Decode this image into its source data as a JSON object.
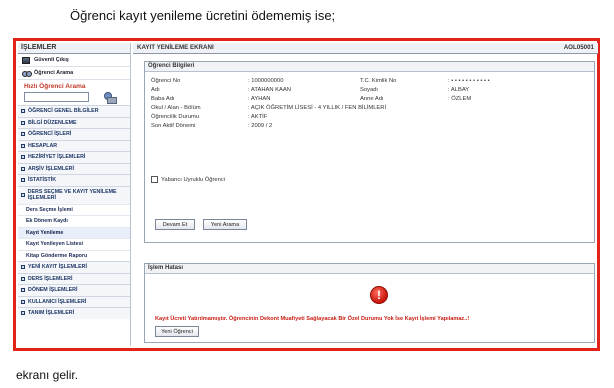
{
  "doc": {
    "intro": "Öğrenci kayıt yenileme ücretini ödememiş ise;",
    "outro": "ekranı gelir."
  },
  "sidebar": {
    "header": "İŞLEMLER",
    "actions": [
      {
        "label": "Güvenli Çıkış",
        "icon": "exit-icon"
      },
      {
        "label": "Öğrenci Arama",
        "icon": "binoculars-icon"
      }
    ],
    "quick_search_title": "Hızlı Öğrenci Arama",
    "quick_search_value": "",
    "menu": [
      "ÖĞRENCİ GENEL BİLGİLER",
      "BİLGİ DÜZENLEME",
      "ÖĞRENCİ İŞLERİ",
      "HESAPLAR",
      "HEZİRİYET İŞLEMLERİ",
      "ARŞİV İŞLEMLERİ",
      "İSTATİSTİK"
    ],
    "menu_open": "DERS SEÇME VE KAYIT YENİLEME İŞLEMLERİ",
    "submenu": [
      "Ders Seçme İşlemi",
      "Ek Dönem Kaydı",
      "Kayıt Yenileme",
      "Kayıt Yenileyen Listesi",
      "Kitap Gönderme Raporu"
    ],
    "menu_after": [
      "YENİ KAYIT İŞLEMLERİ",
      "DERS İŞLEMLERİ",
      "DÖNEM İŞLEMLERİ",
      "KULLANICI İŞLEMLERİ",
      "TANIM İŞLEMLERİ"
    ]
  },
  "main": {
    "title": "KAYIT YENİLEME EKRANI",
    "code": "AOL05001",
    "student_panel": {
      "title": "Öğrenci Bilgileri",
      "rows": [
        {
          "label": "Öğrenci No",
          "value": ": 1000000000",
          "label2": "T.C. Kimlik No",
          "value2": ": • • • • • • • • • • •"
        },
        {
          "label": "Adı",
          "value": ": ATAHAN KAAN",
          "label2": "Soyadı",
          "value2": ": ALBAY"
        },
        {
          "label": "Baba Adı",
          "value": ": AYHAN",
          "label2": "Anne Adı",
          "value2": ": ÖZLEM"
        },
        {
          "label": "Okul / Alan - Bölüm",
          "value": ": AÇIK ÖĞRETİM LİSESİ - 4 YILLIK / FEN BİLİMLERİ",
          "label2": "",
          "value2": ""
        },
        {
          "label": "Öğrencilik Durumu",
          "value": ": AKTİF",
          "label2": "",
          "value2": ""
        },
        {
          "label": "Son Aktif Dönemi",
          "value": ": 2009 / 2",
          "label2": "",
          "value2": ""
        }
      ],
      "checkbox_label": "Yabancı Uyruklu Öğrenci",
      "checkbox_checked": false,
      "continue_button": "Devam Et",
      "new_search_button": "Yeni Arama"
    },
    "error_panel": {
      "title": "İşlem Hatası",
      "message": "Kayıt Ücreti Yatırılmamıştır. Öğrencinin Dekont Muafiyeti Sağlayacak Bir Özel Durumu Yok İse Kayıt İşlemi Yapılamaz..!",
      "new_student_button": "Yeni Öğrenci"
    }
  },
  "colors": {
    "frame_border": "#e2231a",
    "error_text": "#c81d12",
    "menu_text": "#1e3866"
  }
}
